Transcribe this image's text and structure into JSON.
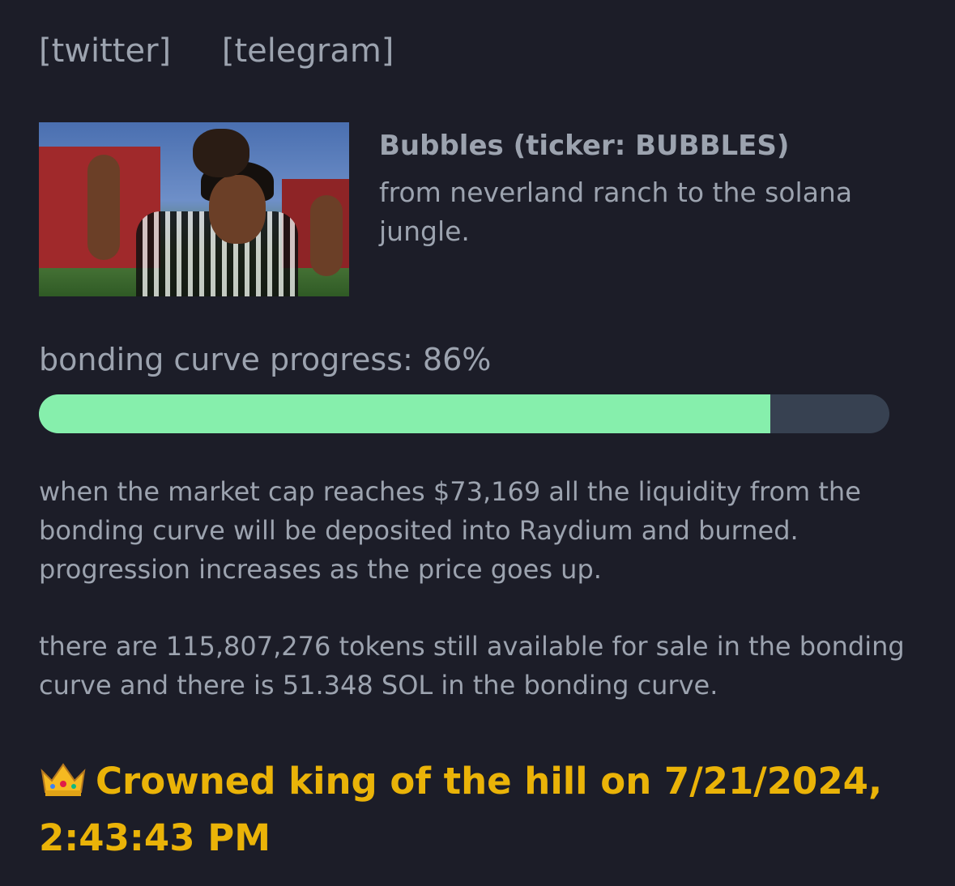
{
  "links": {
    "twitter": "[twitter]",
    "telegram": "[telegram]"
  },
  "token": {
    "name": "Bubbles (ticker: BUBBLES)",
    "description": "from neverland ranch to the solana jungle."
  },
  "progress": {
    "label": "bonding curve progress: 86%",
    "value": 86
  },
  "info": {
    "paragraph1": "when the market cap reaches $73,169 all the liquidity from the bonding curve will be deposited into Raydium and burned. progression increases as the price goes up.",
    "paragraph2": "there are 115,807,276 tokens still available for sale in the bonding curve and there is 51.348 SOL in the bonding curve."
  },
  "king": {
    "text": "Crowned king of the hill on 7/21/2024, 2:43:43 PM"
  },
  "colors": {
    "background": "#1c1d28",
    "text": "#9ca3af",
    "progress_fill": "#86efac",
    "progress_track": "#374151",
    "king": "#eab308"
  }
}
